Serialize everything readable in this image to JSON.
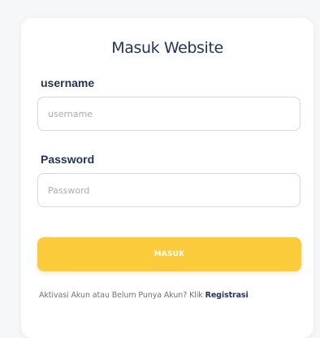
{
  "login": {
    "title": "Masuk Website",
    "username_label": "username",
    "username_placeholder": "username",
    "username_value": "",
    "password_label": "Password",
    "password_placeholder": "Password",
    "password_value": "",
    "submit_label": "MASUK",
    "footer_text": "Aktivasi Akun atau Belum Punya Akun? Klik ",
    "register_link": "Registrasi"
  },
  "colors": {
    "page_background": "#f6f7f9",
    "card_background": "#ffffff",
    "heading": "#23345a",
    "button": "#fbcb3c",
    "input_border": "#d5d9df",
    "muted_text": "#6f737a"
  }
}
